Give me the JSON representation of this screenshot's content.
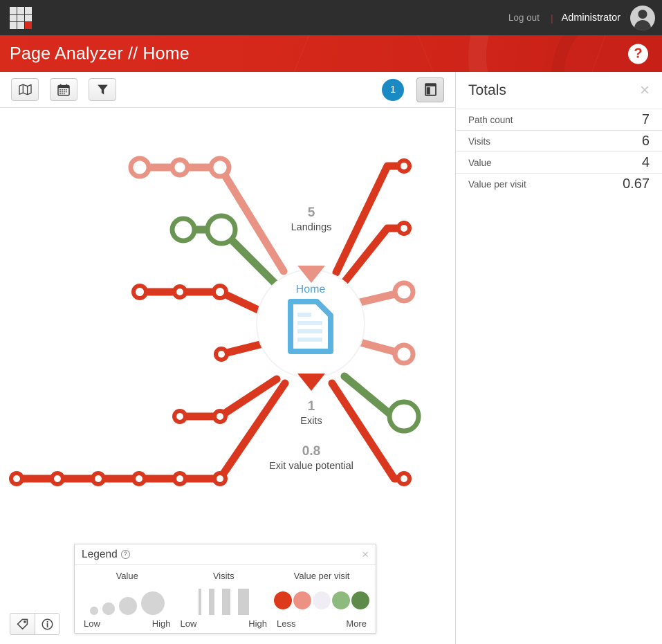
{
  "topbar": {
    "logout_label": "Log out",
    "separator": "|",
    "user_name": "Administrator",
    "logo_icon": "grid-logo-icon",
    "avatar_icon": "user-avatar-icon"
  },
  "banner": {
    "title": "Page Analyzer // Home",
    "help_label": "?",
    "background_color": "#d9291c"
  },
  "toolbar": {
    "buttons": [
      {
        "name": "map-view-button",
        "icon": "map-icon"
      },
      {
        "name": "date-range-button",
        "icon": "calendar-icon"
      },
      {
        "name": "filter-button",
        "icon": "funnel-icon"
      }
    ],
    "badge_count": "1",
    "badge_color": "#1a8ac4",
    "panel_toggle": {
      "name": "toggle-side-panel-button",
      "icon": "panel-layout-icon"
    }
  },
  "diagram": {
    "center_node_label": "Home",
    "center_icon": "document-icon",
    "landings_value": "5",
    "landings_caption": "Landings",
    "exits_value": "1",
    "exits_caption": "Exits",
    "exit_value_potential_value": "0.8",
    "exit_value_potential_caption": "Exit value potential",
    "colors": {
      "strong_red": "#d9381f",
      "light_red": "#e89384",
      "green": "#6a9553",
      "center_blue": "#4aa3d8"
    }
  },
  "legend": {
    "title": "Legend",
    "help_label": "?",
    "close_label": "×",
    "columns": [
      {
        "header": "Value",
        "low_label": "Low",
        "high_label": "High"
      },
      {
        "header": "Visits",
        "low_label": "Low",
        "high_label": "High"
      },
      {
        "header": "Value per visit",
        "low_label": "Less",
        "high_label": "More"
      }
    ],
    "value_circle_sizes": [
      12,
      18,
      26,
      34
    ],
    "visits_bar_heights": [
      22,
      30,
      36,
      42
    ],
    "value_per_visit_colors": [
      "#dd3a1c",
      "#ec9183",
      "#f1edf4",
      "#8fba7d",
      "#5f8b4a"
    ]
  },
  "bottom_tabs": [
    {
      "name": "tags-tab",
      "icon": "tag-icon",
      "active": false
    },
    {
      "name": "info-tab",
      "icon": "info-icon",
      "active": true
    }
  ],
  "totals": {
    "title": "Totals",
    "close_label": "×",
    "rows": [
      {
        "label": "Path count",
        "value": "7"
      },
      {
        "label": "Visits",
        "value": "6"
      },
      {
        "label": "Value",
        "value": "4"
      },
      {
        "label": "Value per visit",
        "value": "0.67"
      }
    ]
  }
}
